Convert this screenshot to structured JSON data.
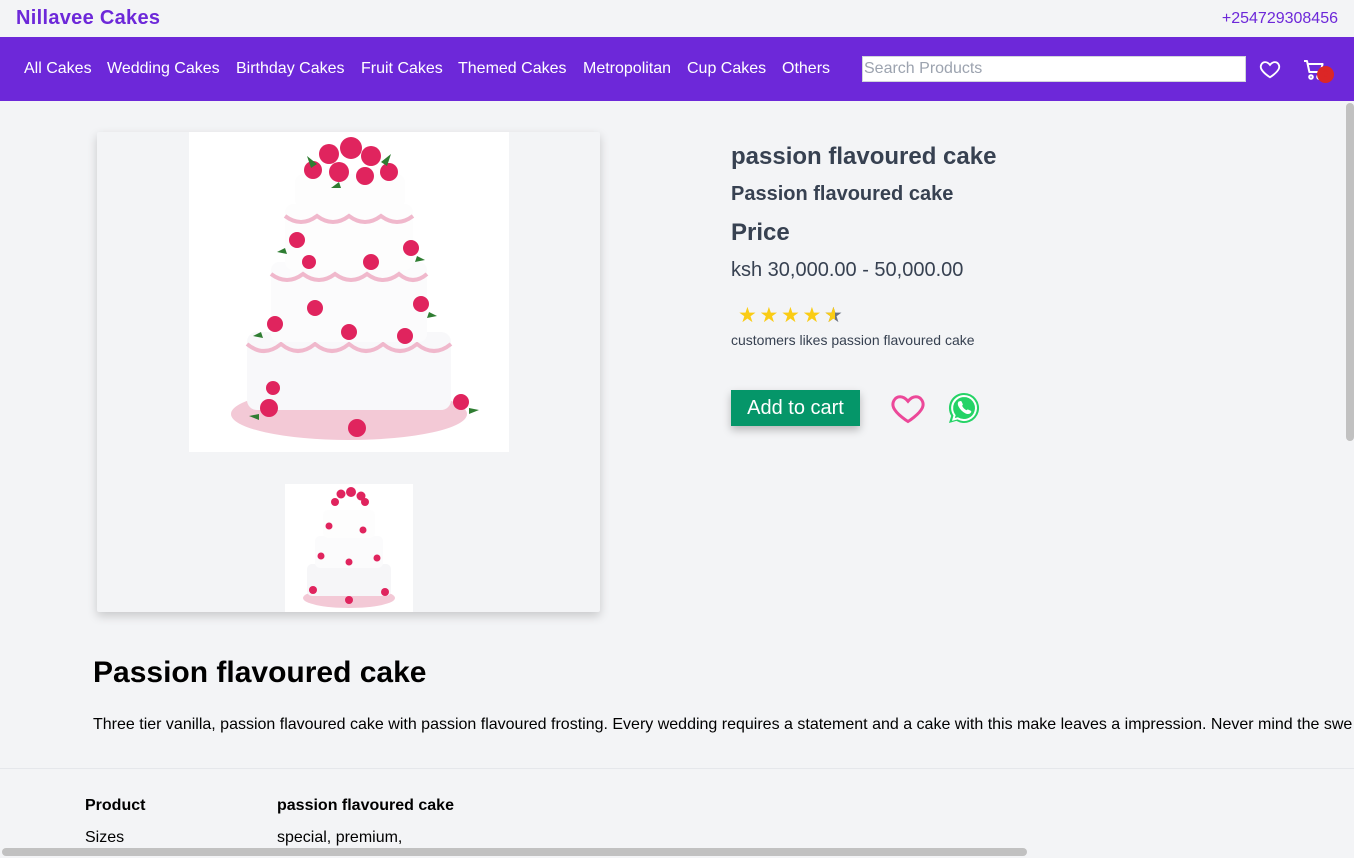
{
  "header": {
    "brand": "Nillavee Cakes",
    "phone": "+254729308456"
  },
  "nav": {
    "items": [
      "All Cakes",
      "Wedding Cakes",
      "Birthday Cakes",
      "Fruit Cakes",
      "Themed Cakes",
      "Metropolitan",
      "Cup Cakes",
      "Others"
    ],
    "search_placeholder": "Search Products",
    "cart_count": "0",
    "icons": [
      "heart-icon",
      "cart-icon"
    ]
  },
  "product": {
    "title": "passion flavoured cake",
    "subtitle": "Passion flavoured cake",
    "price_label": "Price",
    "price": "ksh 30,000.00 - 50,000.00",
    "rating": 4.5,
    "rating_max": 5,
    "likes_text": "customers likes passion flavoured cake",
    "add_to_cart": "Add to cart",
    "colors": {
      "accent": "#6d28d9",
      "button": "#059669",
      "heart": "#ec4899",
      "whatsapp": "#25d366",
      "star": "#facc15"
    }
  },
  "description": {
    "title": "Passion flavoured cake",
    "text": "Three tier vanilla, passion flavoured cake with passion flavoured frosting. Every wedding requires a statement and a cake with this make leaves a impression. Never mind the swe"
  },
  "specs": [
    {
      "key": "Product",
      "value": "passion flavoured cake"
    },
    {
      "key": "Sizes",
      "value": "special, premium,"
    }
  ]
}
